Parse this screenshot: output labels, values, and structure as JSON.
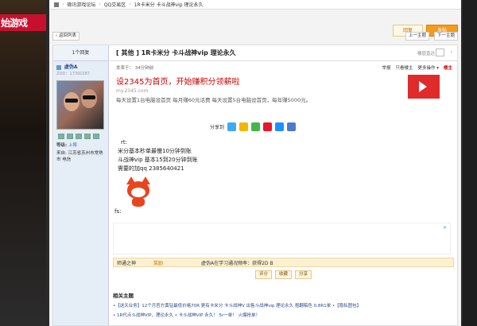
{
  "left_banner": {
    "text": "始游戏"
  },
  "topbar": {
    "site": "微讯游戏论坛",
    "forum": "QQ交易区",
    "thread": "1R卡米分 卡斗战神vip 理论永久"
  },
  "buttons": {
    "reply": "回复",
    "post": "发帖",
    "back": "‹ 返回列表",
    "prev": "上一主题",
    "next": "下一主题"
  },
  "sidebar": {
    "views": "1个回复",
    "username": "虚伪A",
    "uid": "ZilID：17391087",
    "level_label": "等级:",
    "level_value": "上将",
    "from_label": "来自:",
    "from_value": "江苏省苏州市常熟市 电信"
  },
  "thread": {
    "title": "[ 其他 ] 1R卡米分 卡斗战神vip 理论永久",
    "jump_label": "楼层直达",
    "post_time": "发表于：  34分钟前",
    "meta": [
      "举报",
      "只看楼主",
      "更多操作 ▾"
    ],
    "owner": "楼主"
  },
  "ad": {
    "title": "设2345为首页，开始赚积分领薪啦",
    "url": "my.2345.com",
    "desc": "每天设置1台电脑设首页 每月赚60元话费 每天设置5台电脑设首页，每年赚5000元。"
  },
  "share": {
    "label": "分享到"
  },
  "body_lines": [
    "rt:",
    "米分基本秒单最慢10分钟到账",
    "斗战神vip  基本15到20分钟到账",
    "需要的加qq 2385640421"
  ],
  "fs": "fs:",
  "award": {
    "col1": "师通之神",
    "col2": "奖励",
    "col3": "虚伪A在学习通况频率：获得2D B"
  },
  "actions": [
    "评分",
    "收藏",
    "分享"
  ],
  "related": {
    "title": "相关主题",
    "row1": "•【送天业务】12个月官方黄钻最低价格70R   更有卡米分 卡斗战神V   出售斗战神vip 理论永久 抱翻稿色 0.8R1单   •【隐私图包】",
    "row2": "• 1R代点斗战神VIP，理论永久               • 卡斗战神VIP 永久！ 5r一单！ 火爆抢单！"
  }
}
